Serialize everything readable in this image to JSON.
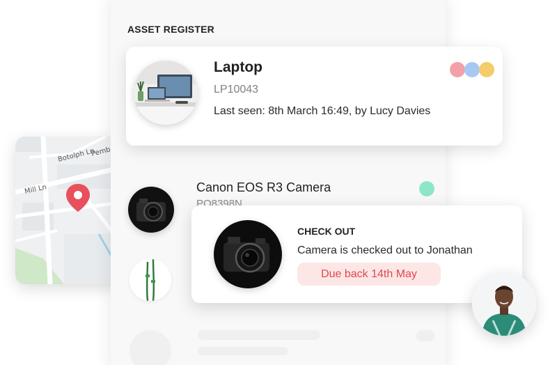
{
  "map": {
    "streets": [
      "Botolph Ln",
      "Pemb",
      "Mill Ln"
    ],
    "pin_color": "#e8505b"
  },
  "panel": {
    "title": "ASSET REGISTER"
  },
  "featured_asset": {
    "name": "Laptop",
    "code": "LP10043",
    "last_seen": "Last seen: 8th March 16:49, by Lucy Davies",
    "tag_colors": [
      "#f4a0a8",
      "#a8c8f4",
      "#f4cc6a"
    ]
  },
  "list": [
    {
      "name": "Canon EOS R3 Camera",
      "code": "PO8398N",
      "status_color": "#8ee6c9",
      "icon": "camera-icon"
    },
    {
      "name": "",
      "code": "",
      "icon": "cable-icon"
    }
  ],
  "checkout": {
    "title": "CHECK OUT",
    "message": "Camera is checked out to Jonathan",
    "due": "Due back 14th May"
  },
  "colors": {
    "accent_red": "#e0474c",
    "pill_bg": "#fde6e6"
  }
}
